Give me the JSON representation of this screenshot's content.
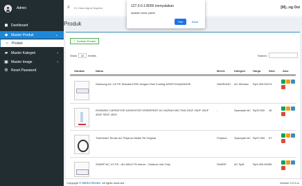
{
  "sidebar": {
    "username": "Admin",
    "items": [
      {
        "label": "Dashboard",
        "icon": "dashboard-icon"
      },
      {
        "label": "Master Produk",
        "icon": "cube-icon"
      },
      {
        "label": "Produk",
        "icon": "circle-icon"
      },
      {
        "label": "Master Kategori",
        "icon": "folder-icon"
      },
      {
        "label": "Master Image",
        "icon": "image-icon"
      },
      {
        "label": "Reset Password",
        "icon": "gear-icon"
      }
    ]
  },
  "topbar": {
    "greeting": "Hi, Dana Agna Saputra",
    "right_text": "[M]...ng Out"
  },
  "dialog": {
    "title": "127.0.0.1:8000 menyatakan",
    "message": "Apakah anda yakin!",
    "ok": "Oke",
    "cancel": "Batal"
  },
  "page": {
    "title": "Produk"
  },
  "toolbar": {
    "add_label": "Tambah Produk"
  },
  "table_controls": {
    "show": "Show",
    "entries_value": "10",
    "entries": "entries",
    "search": "Search:"
  },
  "table": {
    "headers": [
      "Gambar",
      "Nama",
      "Merek",
      "Kategori",
      "Harga",
      "Stok",
      "Aksi"
    ],
    "rows": [
      {
        "nama": "Samsung AC 1/2 PK Standard R32 dengan Fast Cooling AR05TGHQASINSE",
        "merek": "SAMSUNG",
        "kategori": "AC Window",
        "harga": "Rp4.099.000",
        "stok": "74"
      },
      {
        "nama": "RUNNING CAPASITOR KAPASITOR SPAREPART AC MURAH MIC PAN 20UF 25UF 35UF 45UF 50UF 450V",
        "merek": "-",
        "kategori": "Sparepart AC",
        "harga": "Rp30.500",
        "stok": "45"
      },
      {
        "nama": "Thermistor Termis AC Polytron Midea Tsl Original",
        "merek": "Polytron",
        "kategori": "Sparepart AC",
        "harga": "Rp97.500",
        "stok": "67"
      },
      {
        "nama": "SHARP AC 1/2 PK - AH-A5UCYN Indoor - Outdoor Unit Only",
        "merek": "SHARP",
        "kategori": "AC Split",
        "harga": "Rp3.050.000",
        "stok": "56"
      }
    ]
  },
  "footer": {
    "copyright_prefix": "Copyright ©",
    "brand": "MEROTEKNIK",
    "rights": ". All rights reserved.",
    "version": "Version 3.2.0-rc"
  }
}
